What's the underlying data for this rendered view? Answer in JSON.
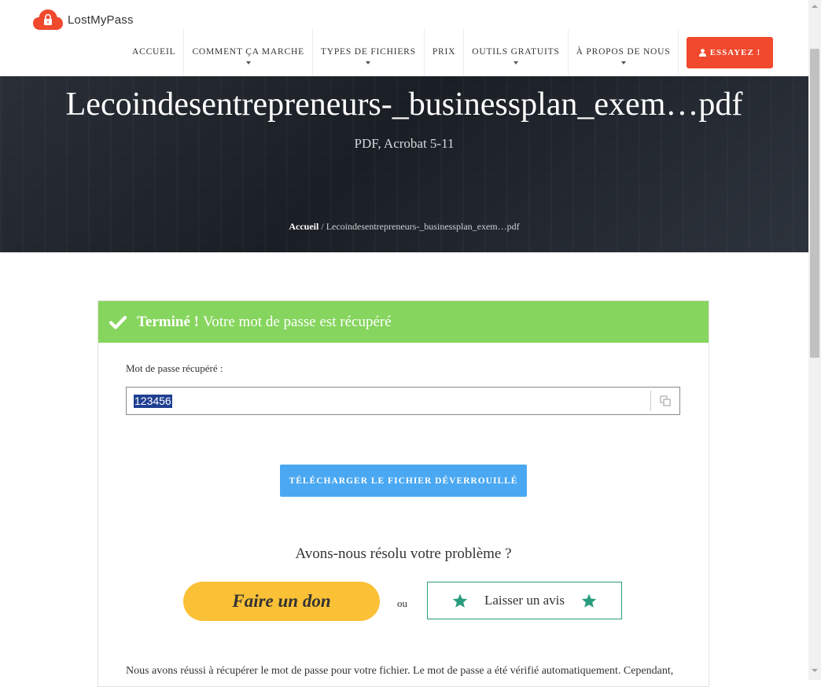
{
  "brand": {
    "name": "LostMyPass",
    "logo_icon": "cloud-lock-icon",
    "color": "#f0492d"
  },
  "nav": {
    "items": [
      {
        "label": "ACCUEIL",
        "has_dropdown": false
      },
      {
        "label": "COMMENT ÇA MARCHE",
        "has_dropdown": true
      },
      {
        "label": "TYPES DE FICHIERS",
        "has_dropdown": true
      },
      {
        "label": "PRIX",
        "has_dropdown": false
      },
      {
        "label": "OUTILS GRATUITS",
        "has_dropdown": true
      },
      {
        "label": "À PROPOS DE NOUS",
        "has_dropdown": true
      }
    ],
    "cta_label": "ESSAYEZ !",
    "cta_icon": "user-icon"
  },
  "hero": {
    "title": "Lecoindesentrepreneurs-_businessplan_exem…pdf",
    "subtitle": "PDF, Acrobat 5-11",
    "breadcrumb": {
      "home": "Accueil",
      "separator": " / ",
      "current": "Lecoindesentrepreneurs-_businessplan_exem…pdf"
    }
  },
  "result": {
    "status_bold": "Terminé !",
    "status_text": "Votre mot de passe est récupéré",
    "status_color": "#86d55e",
    "password_label": "Mot de passe récupéré :",
    "password_value": "123456",
    "copy_icon": "copy-icon",
    "download_label": "TÉLÉCHARGER LE FICHIER DÉVERROUILLÉ",
    "download_color": "#4aa8f2"
  },
  "feedback": {
    "question": "Avons-nous résolu votre problème ?",
    "donate_label": "Faire un don",
    "or_label": "ou",
    "review_label": "Laisser un avis",
    "review_icon": "star-icon"
  },
  "note": "Nous avons réussi à récupérer le mot de passe pour votre fichier. Le mot de passe a été vérifié automatiquement. Cependant,"
}
